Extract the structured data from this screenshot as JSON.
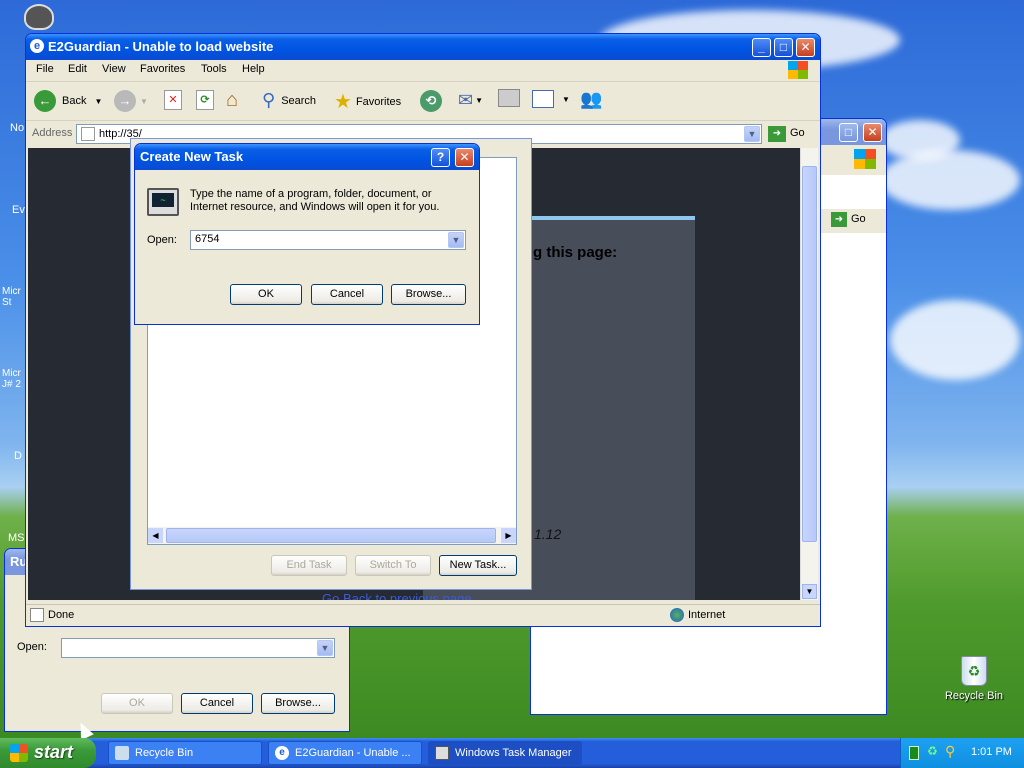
{
  "desktop": {
    "recycle_bin_label": "Recycle Bin",
    "partial_icon_labels": [
      "No",
      "Ev",
      "Micr St",
      "Micr J# 2",
      "D",
      "MS"
    ]
  },
  "ie_window": {
    "title": "E2Guardian - Unable to load website",
    "menu": [
      "File",
      "Edit",
      "View",
      "Favorites",
      "Tools",
      "Help"
    ],
    "toolbar": {
      "back": "Back",
      "search": "Search",
      "favorites": "Favorites"
    },
    "address_label": "Address",
    "address_value": "http://35/",
    "go_label": "Go",
    "page_heading_partial": "g this page:",
    "page_version_partial": "1.12",
    "page_link_partial": "Go Back to previous page",
    "status_left": "Done",
    "status_zone": "Internet"
  },
  "back_window": {
    "go_label": "Go"
  },
  "task_manager": {
    "buttons": {
      "end_task": "End Task",
      "switch_to": "Switch To",
      "new_task": "New Task..."
    }
  },
  "create_task": {
    "title": "Create New Task",
    "description": "Type the name of a program, folder, document, or Internet resource, and Windows will open it for you.",
    "open_label": "Open:",
    "open_value": "6754",
    "ok": "OK",
    "cancel": "Cancel",
    "browse": "Browse..."
  },
  "run_dialog": {
    "title_partial": "Ru",
    "open_label": "Open:",
    "open_value": "",
    "ok": "OK",
    "cancel": "Cancel",
    "browse": "Browse..."
  },
  "taskbar": {
    "start": "start",
    "tasks": [
      "Recycle Bin",
      "E2Guardian - Unable ...",
      "Windows Task Manager"
    ],
    "clock": "1:01 PM"
  }
}
